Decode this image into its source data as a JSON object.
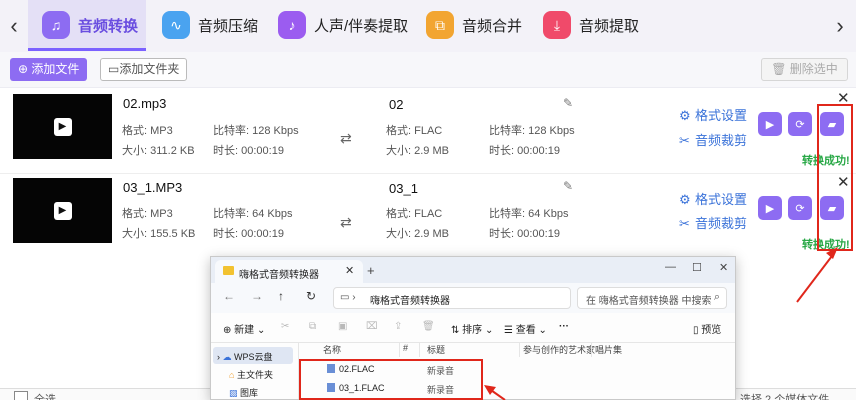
{
  "tabs": [
    {
      "label": "音频转换",
      "icon": "headphones-icon",
      "color": "#8d6cf2"
    },
    {
      "label": "音频压缩",
      "icon": "waveform-icon",
      "color": "#4aa3f0"
    },
    {
      "label": "人声/伴奏提取",
      "icon": "vocal-icon",
      "color": "#9b5cf0"
    },
    {
      "label": "音频合并",
      "icon": "merge-icon",
      "color": "#f2a531"
    },
    {
      "label": "音频提取",
      "icon": "extract-icon",
      "color": "#f04a6a"
    }
  ],
  "toolbar": {
    "add_file": "添加文件",
    "add_folder": "添加文件夹",
    "delete_selected": "删除选中"
  },
  "files": [
    {
      "source_name": "02.mp3",
      "source_format": "格式: MP3",
      "source_bitrate": "比特率: 128 Kbps",
      "source_size": "大小: 311.2 KB",
      "source_duration": "时长:   00:00:19",
      "output_name": "02",
      "output_format": "格式: FLAC",
      "output_bitrate": "比特率: 128 Kbps",
      "output_size": "大小: 2.9 MB",
      "output_duration": "时长:   00:00:19",
      "format_setting": "格式设置",
      "audio_trim": "音频裁剪",
      "status": "转换成功!"
    },
    {
      "source_name": "03_1.MP3",
      "source_format": "格式: MP3",
      "source_bitrate": "比特率: 64 Kbps",
      "source_size": "大小: 155.5 KB",
      "source_duration": "时长:   00:00:19",
      "output_name": "03_1",
      "output_format": "格式: FLAC",
      "output_bitrate": "比特率: 64 Kbps",
      "output_size": "大小: 2.9 MB",
      "output_duration": "时长:   00:00:19",
      "format_setting": "格式设置",
      "audio_trim": "音频裁剪",
      "status": "转换成功!"
    }
  ],
  "bottom": {
    "select_all": "全选",
    "count_text": "选择 2 个媒体文件"
  },
  "explorer": {
    "tab_title": "嗨格式音频转换器",
    "path": "嗨格式音频转换器",
    "search_placeholder": "在 嗨格式音频转换器 中搜索",
    "new_label": "新建",
    "sort_label": "排序",
    "view_label": "查看",
    "more_label": "···",
    "preview_label": "预览",
    "nav_items": [
      "WPS云盘",
      "主文件夹",
      "图库"
    ],
    "columns": [
      "名称",
      "#",
      "标题",
      "参与创作的艺术家",
      "唱片集"
    ],
    "files": [
      {
        "name": "02.FLAC",
        "title": "新录音"
      },
      {
        "name": "03_1.FLAC",
        "title": "新录音"
      }
    ]
  }
}
